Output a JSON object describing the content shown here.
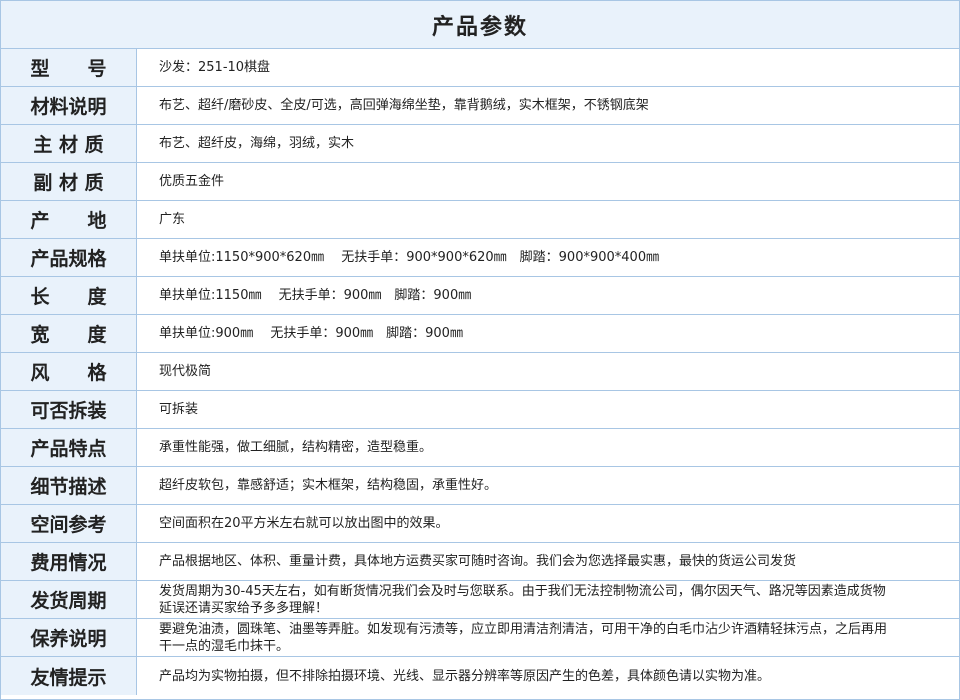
{
  "title": "产品参数",
  "rows": [
    {
      "label": "型　　号",
      "value": "沙发：251-10棋盘"
    },
    {
      "label": "材料说明",
      "value": "布艺、超纤/磨砂皮、全皮/可选，高回弹海绵坐垫，靠背鹅绒，实木框架，不锈钢底架"
    },
    {
      "label": "主 材 质",
      "value": "布艺、超纤皮，海绵，羽绒，实木"
    },
    {
      "label": "副 材 质",
      "value": "优质五金件"
    },
    {
      "label": "产　　地",
      "value": "广东"
    },
    {
      "label": "产品规格",
      "value": "单扶单位:1150*900*620㎜　 无扶手单：900*900*620㎜　脚踏：900*900*400㎜"
    },
    {
      "label": "长　　度",
      "value": "单扶单位:1150㎜　 无扶手单：900㎜　脚踏：900㎜"
    },
    {
      "label": "宽　　度",
      "value": "单扶单位:900㎜　 无扶手单：900㎜　脚踏：900㎜"
    },
    {
      "label": "风　　格",
      "value": "现代极简"
    },
    {
      "label": "可否拆装",
      "value": "可拆装"
    },
    {
      "label": "产品特点",
      "value": "承重性能强，做工细腻，结构精密，造型稳重。"
    },
    {
      "label": "细节描述",
      "value": "超纤皮软包，靠感舒适；实木框架，结构稳固，承重性好。"
    },
    {
      "label": "空间参考",
      "value": "空间面积在20平方米左右就可以放出图中的效果。"
    },
    {
      "label": "费用情况",
      "value": "产品根据地区、体积、重量计费，具体地方运费买家可随时咨询。我们会为您选择最实惠，最快的货运公司发货"
    },
    {
      "label": "发货周期",
      "value": "发货周期为30-45天左右，如有断货情况我们会及时与您联系。由于我们无法控制物流公司，偶尔因天气、路况等因素造成货物延误还请买家给予多多理解！"
    },
    {
      "label": "保养说明",
      "value": "要避免油渍，圆珠笔、油墨等弄脏。如发现有污渍等，应立即用清洁剂清洁，可用干净的白毛巾沾少许酒精轻抹污点，之后再用干一点的湿毛巾抹干。"
    },
    {
      "label": "友情提示",
      "value": "产品均为实物拍摄，但不排除拍摄环境、光线、显示器分辨率等原因产生的色差，具体颜色请以实物为准。"
    }
  ]
}
